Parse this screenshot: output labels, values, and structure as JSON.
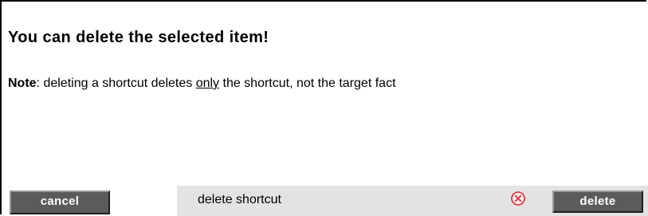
{
  "dialog": {
    "title": "You can delete the selected item!",
    "note_label": "Note",
    "note_text_before": ": deleting a shortcut deletes ",
    "note_emphasis": "only",
    "note_text_after": " the shortcut, not the target fact"
  },
  "actions": {
    "cancel_label": "cancel",
    "delete_item_label": "delete shortcut",
    "delete_label": "delete",
    "remove_icon": "circle-x-icon",
    "remove_icon_color": "#e3262d"
  },
  "colors": {
    "button_bg": "#5b5b5b",
    "button_text": "#ffffff",
    "bar_bg": "#e3e3e3"
  }
}
